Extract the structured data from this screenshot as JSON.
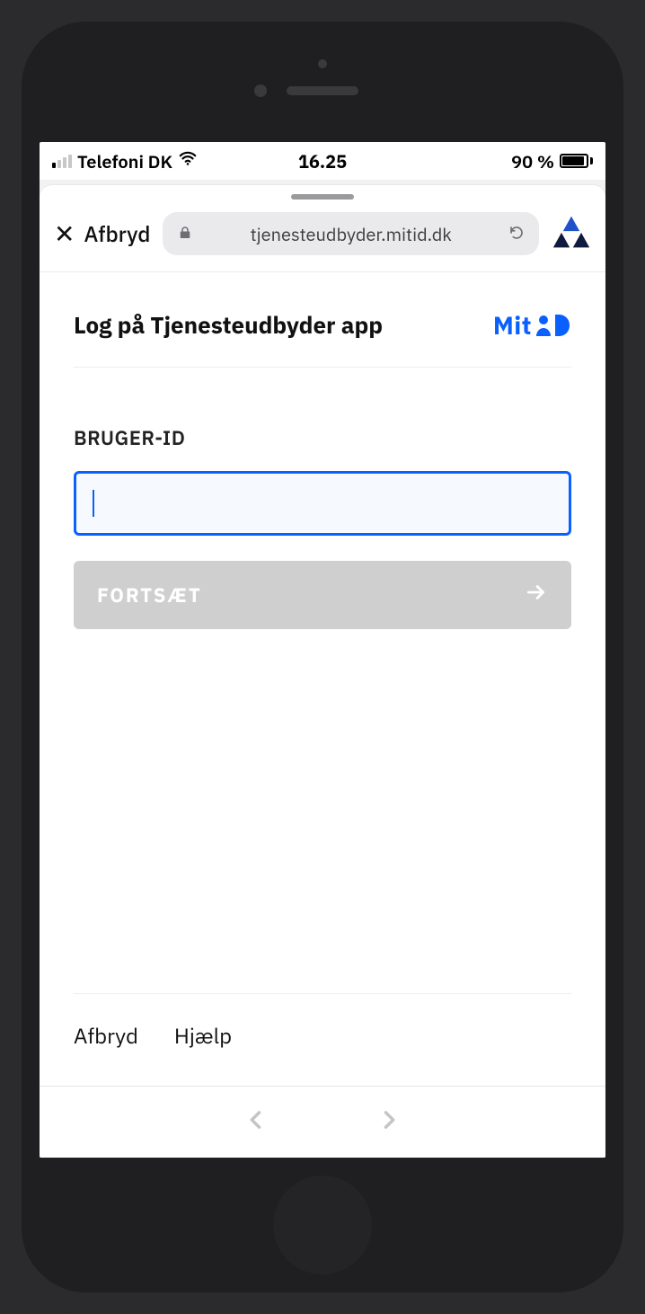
{
  "status": {
    "carrier": "Telefoni DK",
    "time": "16.25",
    "battery_pct": "90 %"
  },
  "browser": {
    "cancel_label": "Afbryd",
    "url": "tjenesteudbyder.mitid.dk"
  },
  "page": {
    "title": "Log på Tjenesteudbyder app",
    "brand": "Mit",
    "field_label": "BRUGER-ID",
    "input_value": "",
    "continue_label": "FORTSÆT"
  },
  "footer": {
    "cancel": "Afbryd",
    "help": "Hjælp"
  },
  "colors": {
    "accent": "#0a60ff",
    "disabled": "#cfcfcf",
    "triangle_dark": "#0f1a3f",
    "triangle_blue": "#1f52c9"
  }
}
